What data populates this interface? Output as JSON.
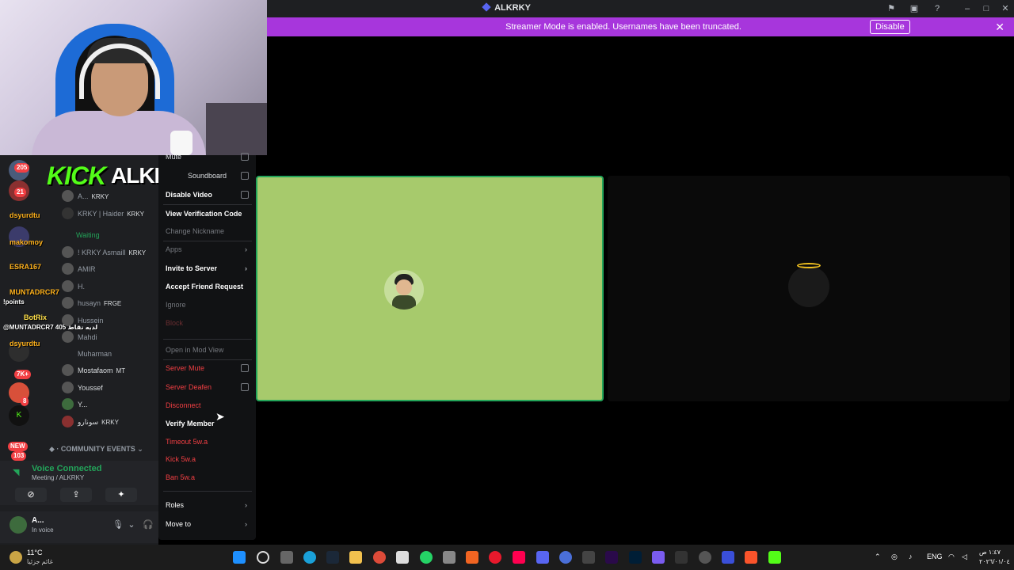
{
  "window": {
    "title": "ALKRKY"
  },
  "banner": {
    "message": "Streamer Mode is enabled. Usernames have been truncated.",
    "disable_label": "Disable"
  },
  "overlay": {
    "kick_word": "KICK",
    "streamer_name": "ALKRKY99"
  },
  "server_badges": [
    "205",
    "21",
    "7K+",
    "8",
    "NEW",
    "103"
  ],
  "chat": [
    {
      "name": "dsyurdtu",
      "text": ""
    },
    {
      "name": "makomoy",
      "text": ""
    },
    {
      "name": "ESRA167",
      "text": ""
    },
    {
      "name": "MUNTADRCR7",
      "text": "!points"
    },
    {
      "name": "BotRix",
      "text": "@MUNTADRCR7 405 لديه نقاط"
    },
    {
      "name": "dsyurdtu",
      "text": ""
    }
  ],
  "voice_members": [
    {
      "name": "A...",
      "tag": "KRKY"
    },
    {
      "name": "KRKY | Haider",
      "tag": "KRKY"
    },
    {
      "name": "Waiting",
      "tag": ""
    },
    {
      "name": "! KRKY Asmaill",
      "tag": "KRKY"
    },
    {
      "name": "AMIR",
      "tag": ""
    },
    {
      "name": "H.",
      "tag": ""
    },
    {
      "name": "husayn",
      "tag": "FRGE"
    },
    {
      "name": "Hussein",
      "tag": ""
    },
    {
      "name": "Mahdi",
      "tag": ""
    },
    {
      "name": "Muharman",
      "tag": ""
    },
    {
      "name": "Mostafaom",
      "tag": "MT"
    },
    {
      "name": "Youssef",
      "tag": ""
    },
    {
      "name": "Y...",
      "tag": ""
    },
    {
      "name": "سونارو",
      "tag": "KRKY"
    }
  ],
  "section": {
    "community_events": "COMMUNITY EVENTS"
  },
  "voice_panel": {
    "status": "Voice Connected",
    "location": "Meeting / ALKRKY"
  },
  "user_panel": {
    "name": "A...",
    "status": "In voice"
  },
  "context_menu": {
    "mute": "Mute",
    "soundboard": "Soundboard",
    "disable_video": "Disable Video",
    "view_verification": "View Verification Code",
    "change_nickname": "Change Nickname",
    "apps": "Apps",
    "invite_to_server": "Invite to Server",
    "accept_friend": "Accept Friend Request",
    "ignore": "Ignore",
    "block": "Block",
    "open_mod_view": "Open in Mod View",
    "server_mute": "Server Mute",
    "server_deafen": "Server Deafen",
    "disconnect": "Disconnect",
    "verify_member": "Verify Member",
    "timeout": "Timeout 5w.a",
    "kick": "Kick 5w.a",
    "ban": "Ban 5w.a",
    "roles": "Roles",
    "move_to": "Move to"
  },
  "taskbar": {
    "weather_temp": "11°C",
    "weather_desc": "غائم جزئيا",
    "lang": "ENG",
    "time": "١:٤٧ ص",
    "date": "٢٠٢٦/٠١/٠٤"
  },
  "colors": {
    "banner": "#a736dc",
    "tile_green": "#a7ca6c",
    "speaking": "#23a55a",
    "danger": "#f23f43",
    "kick_green": "#53fc18"
  }
}
